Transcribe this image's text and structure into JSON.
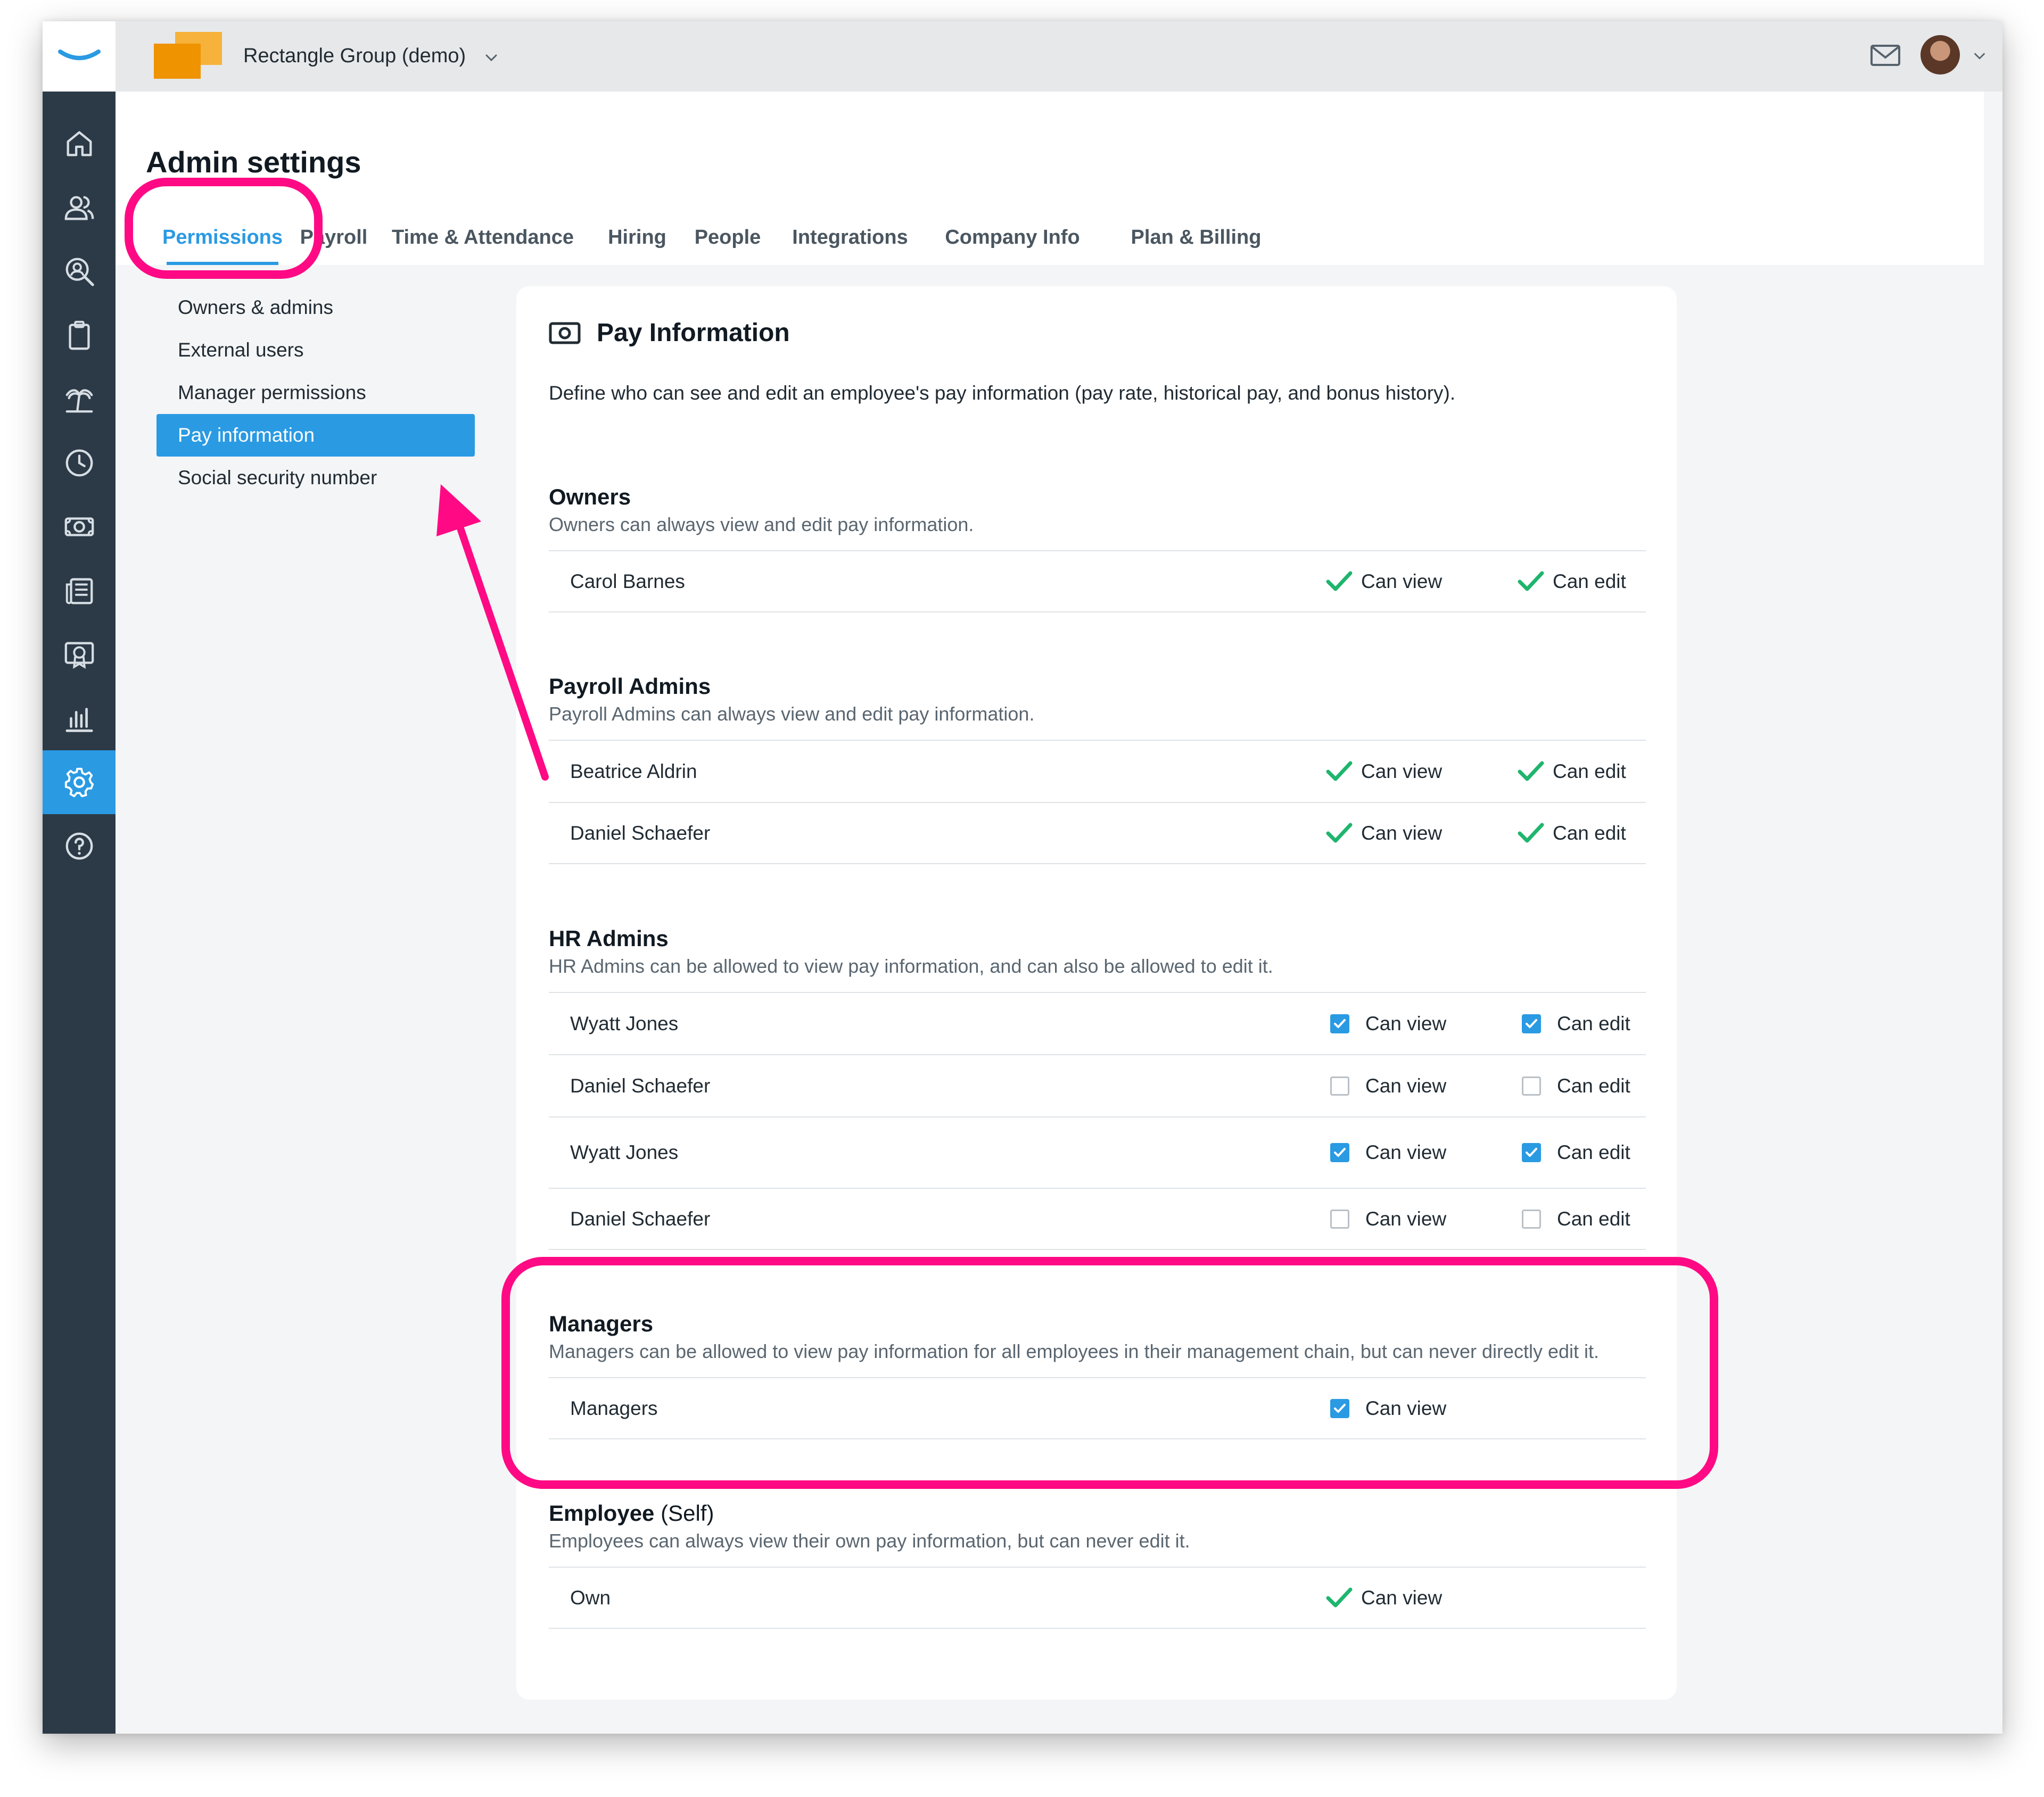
{
  "app": {
    "company_name": "Rectangle Group (demo)",
    "accent_color": "#2a9ae3",
    "brand_color": "#f0a11b",
    "annotation_color": "#ff0a84"
  },
  "sidebar": {
    "items": [
      {
        "icon": "home-icon"
      },
      {
        "icon": "people-icon"
      },
      {
        "icon": "search-person-icon"
      },
      {
        "icon": "clipboard-icon"
      },
      {
        "icon": "palm-tree-icon"
      },
      {
        "icon": "clock-icon"
      },
      {
        "icon": "money-icon"
      },
      {
        "icon": "newspaper-icon"
      },
      {
        "icon": "certificate-icon"
      },
      {
        "icon": "bar-chart-icon"
      },
      {
        "icon": "gear-icon",
        "active": true
      },
      {
        "icon": "help-icon"
      }
    ]
  },
  "header": {
    "title": "Admin settings",
    "tabs": [
      {
        "label": "Permissions",
        "active": true
      },
      {
        "label": "Payroll"
      },
      {
        "label": "Time & Attendance"
      },
      {
        "label": "Hiring"
      },
      {
        "label": "People"
      },
      {
        "label": "Integrations"
      },
      {
        "label": "Company Info"
      },
      {
        "label": "Plan & Billing"
      }
    ]
  },
  "subnav": {
    "items": [
      {
        "label": "Owners & admins"
      },
      {
        "label": "External users"
      },
      {
        "label": "Manager permissions"
      },
      {
        "label": "Pay information",
        "active": true
      },
      {
        "label": "Social security number"
      }
    ]
  },
  "card": {
    "title": "Pay Information",
    "description": "Define who can see and edit an employee's pay information (pay rate, historical pay, and bonus history).",
    "view_label": "Can view",
    "edit_label": "Can edit",
    "sections": [
      {
        "title": "Owners",
        "subtitle": "Owners can always view and edit pay information.",
        "rows": [
          {
            "name": "Carol Barnes",
            "view": "check",
            "edit": "check"
          }
        ]
      },
      {
        "title": "Payroll Admins",
        "subtitle": "Payroll Admins can always view and edit pay information.",
        "rows": [
          {
            "name": "Beatrice Aldrin",
            "view": "check",
            "edit": "check"
          },
          {
            "name": "Daniel Schaefer",
            "view": "check",
            "edit": "check"
          }
        ]
      },
      {
        "title": "HR Admins",
        "subtitle": "HR Admins can be allowed to view pay information, and can also be allowed to edit it.",
        "rows": [
          {
            "name": "Wyatt Jones",
            "view": "checked",
            "edit": "checked"
          },
          {
            "name": "Daniel Schaefer",
            "view": "unchecked",
            "edit": "unchecked"
          },
          {
            "name": "Wyatt Jones",
            "view": "checked",
            "edit": "checked"
          },
          {
            "name": "Daniel Schaefer",
            "view": "unchecked",
            "edit": "unchecked"
          }
        ]
      },
      {
        "title": "Managers",
        "subtitle": "Managers can be allowed to view pay information for all employees in their management chain, but can never directly edit it.",
        "rows": [
          {
            "name": "Managers",
            "view": "checked"
          }
        ]
      },
      {
        "title": "Employee",
        "title_suffix": "(Self)",
        "subtitle": "Employees can always view their own pay information, but can never edit it.",
        "rows": [
          {
            "name": "Own",
            "view": "check"
          }
        ]
      }
    ]
  }
}
